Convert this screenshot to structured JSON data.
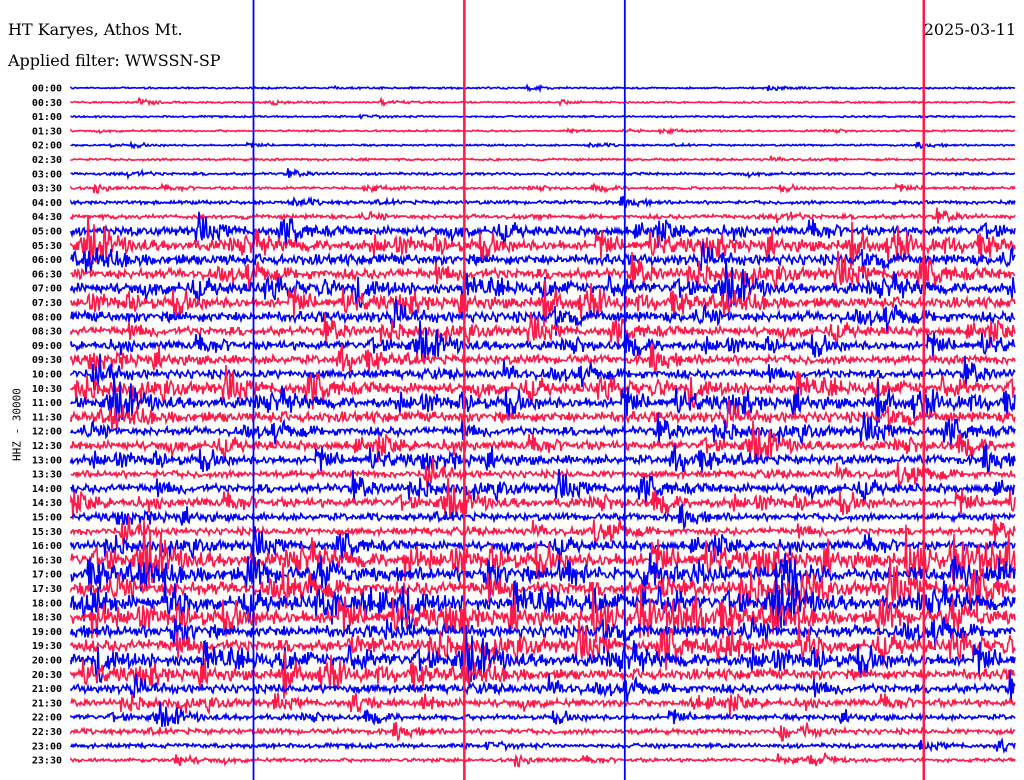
{
  "header": {
    "station": "HT Karyes, Athos Mt.",
    "filter": "Applied filter: WWSSN-SP",
    "date": "2025-03-11"
  },
  "chart_data": {
    "type": "line",
    "title": "HT Karyes, Athos Mt.",
    "subtitle": "Applied filter: WWSSN-SP",
    "ylabel": "HHZ - 30000",
    "xlabel": "",
    "minutes_per_row": 30,
    "colors": [
      "#0000ff",
      "#ff1a4a"
    ],
    "rows": [
      "00:00",
      "00:30",
      "01:00",
      "01:30",
      "02:00",
      "02:30",
      "03:00",
      "03:30",
      "04:00",
      "04:30",
      "05:00",
      "05:30",
      "06:00",
      "06:30",
      "07:00",
      "07:30",
      "08:00",
      "08:30",
      "09:00",
      "09:30",
      "10:00",
      "10:30",
      "11:00",
      "11:30",
      "12:00",
      "12:30",
      "13:00",
      "13:30",
      "14:00",
      "14:30",
      "15:00",
      "15:30",
      "16:00",
      "16:30",
      "17:00",
      "17:30",
      "18:00",
      "18:30",
      "19:00",
      "19:30",
      "20:00",
      "20:30",
      "21:00",
      "21:30",
      "22:00",
      "22:30",
      "23:00",
      "23:30"
    ],
    "relative_noise_level": [
      1,
      1,
      1,
      1,
      1,
      1.3,
      1.5,
      1.5,
      2,
      2.5,
      5,
      6,
      6,
      6,
      6,
      6,
      6,
      5,
      5,
      5,
      5,
      6,
      6,
      6,
      5,
      5,
      5,
      4,
      5,
      5,
      4,
      4,
      5,
      8,
      8,
      8,
      8,
      8,
      7,
      7,
      7,
      6,
      5,
      4,
      3,
      3,
      2.5,
      2
    ],
    "large_events": [
      {
        "minute": 5.8,
        "color": "#0000ff"
      },
      {
        "minute": 12.5,
        "color": "#ff1a4a"
      },
      {
        "minute": 17.6,
        "color": "#0000ff"
      },
      {
        "minute": 27.1,
        "color": "#ff1a4a"
      }
    ]
  }
}
